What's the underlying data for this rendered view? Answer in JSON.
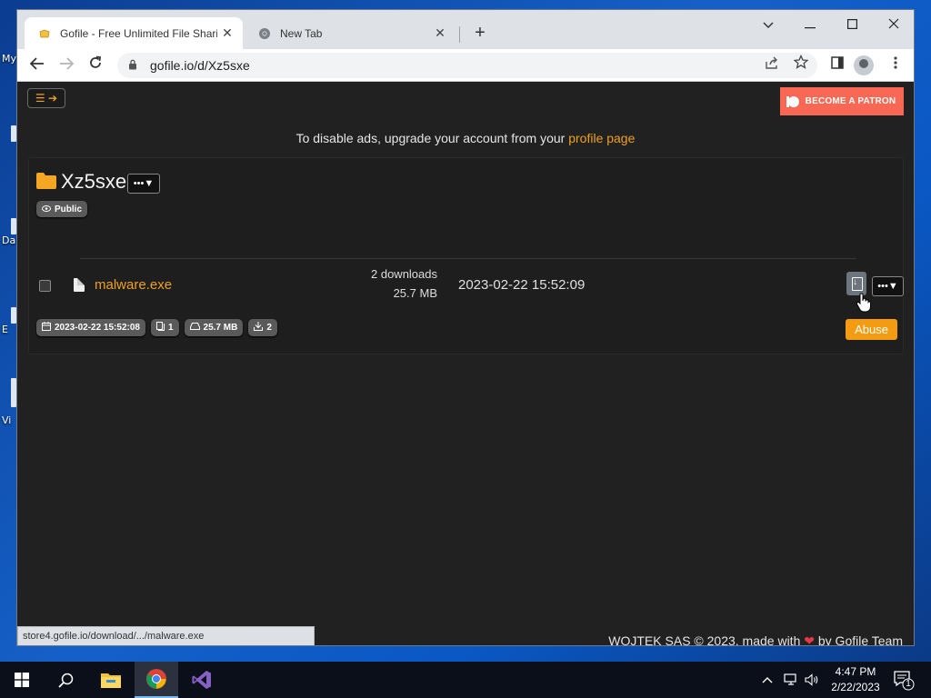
{
  "desktop": {
    "icon_labels": [
      "My",
      "Da",
      "E",
      "Vi"
    ]
  },
  "browser": {
    "tabs": [
      {
        "title": "Gofile - Free Unlimited File Sharing",
        "favicon": "gofile-favicon",
        "active": true
      },
      {
        "title": "New Tab",
        "favicon": "chrome-icon",
        "active": false
      }
    ],
    "address": "gofile.io/d/Xz5sxe",
    "status_url": "store4.gofile.io/download/.../malware.exe"
  },
  "page": {
    "patron_label": "BECOME A PATRON",
    "ad_notice_text": "To disable ads, upgrade your account from your ",
    "ad_notice_link": "profile page",
    "folder": {
      "name": "Xz5sxe",
      "visibility": "Public",
      "stats": {
        "created": "2023-02-22 15:52:08",
        "file_count": "1",
        "total_size": "25.7 MB",
        "downloads": "2"
      },
      "abuse_label": "Abuse"
    },
    "files": [
      {
        "name": "malware.exe",
        "downloads": "2 downloads",
        "size": "25.7 MB",
        "date": "2023-02-22 15:52:09"
      }
    ],
    "footer": {
      "before": "WOJTEK SAS © 2023, made with ",
      "after": " by Gofile Team"
    }
  },
  "taskbar": {
    "time": "4:47 PM",
    "date": "2/22/2023",
    "notification_count": "1"
  },
  "colors": {
    "accent": "#f0a020",
    "patron": "#f96854",
    "abuse": "#f39c12",
    "page_bg": "#212121"
  }
}
